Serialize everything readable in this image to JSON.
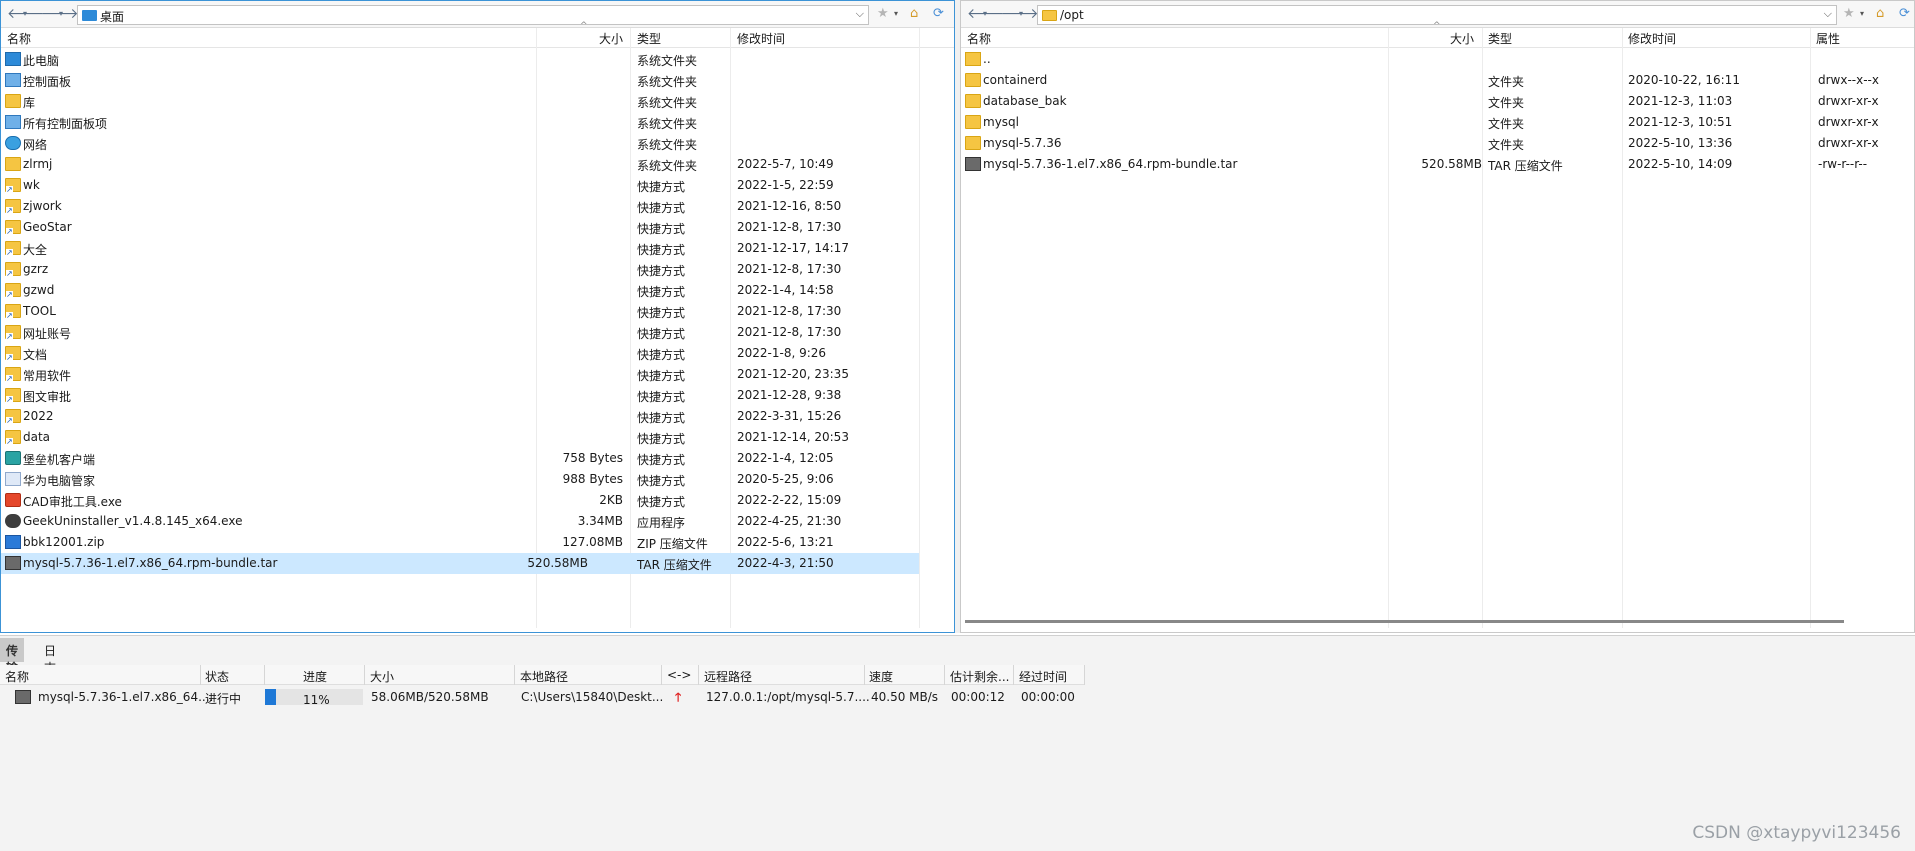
{
  "colors": {
    "accent": "#3c93d6",
    "selection": "#cce8ff",
    "progress": "#1e78d6",
    "upload_arrow": "#e02020"
  },
  "left": {
    "path": "桌面",
    "columns": {
      "name": "名称",
      "size": "大小",
      "type": "类型",
      "modified": "修改时间"
    },
    "rows": [
      {
        "icon": "pc-icon",
        "name": "此电脑",
        "size": "",
        "type": "系统文件夹",
        "modified": ""
      },
      {
        "icon": "control-panel-icon",
        "name": "控制面板",
        "size": "",
        "type": "系统文件夹",
        "modified": ""
      },
      {
        "icon": "folder-icon",
        "name": "库",
        "size": "",
        "type": "系统文件夹",
        "modified": ""
      },
      {
        "icon": "control-panel-icon",
        "name": "所有控制面板项",
        "size": "",
        "type": "系统文件夹",
        "modified": ""
      },
      {
        "icon": "network-icon",
        "name": "网络",
        "size": "",
        "type": "系统文件夹",
        "modified": ""
      },
      {
        "icon": "folder-icon",
        "name": "zlrmj",
        "size": "",
        "type": "系统文件夹",
        "modified": "2022-5-7, 10:49"
      },
      {
        "icon": "folder-shortcut-icon",
        "name": "wk",
        "size": "",
        "type": "快捷方式",
        "modified": "2022-1-5, 22:59"
      },
      {
        "icon": "folder-shortcut-icon",
        "name": "zjwork",
        "size": "",
        "type": "快捷方式",
        "modified": "2021-12-16, 8:50"
      },
      {
        "icon": "folder-shortcut-icon",
        "name": "GeoStar",
        "size": "",
        "type": "快捷方式",
        "modified": "2021-12-8, 17:30"
      },
      {
        "icon": "folder-shortcut-icon",
        "name": "大全",
        "size": "",
        "type": "快捷方式",
        "modified": "2021-12-17, 14:17"
      },
      {
        "icon": "folder-shortcut-icon",
        "name": "gzrz",
        "size": "",
        "type": "快捷方式",
        "modified": "2021-12-8, 17:30"
      },
      {
        "icon": "folder-shortcut-icon",
        "name": "gzwd",
        "size": "",
        "type": "快捷方式",
        "modified": "2022-1-4, 14:58"
      },
      {
        "icon": "folder-shortcut-icon",
        "name": "TOOL",
        "size": "",
        "type": "快捷方式",
        "modified": "2021-12-8, 17:30"
      },
      {
        "icon": "folder-shortcut-icon",
        "name": "网址账号",
        "size": "",
        "type": "快捷方式",
        "modified": "2021-12-8, 17:30"
      },
      {
        "icon": "folder-shortcut-icon",
        "name": "文档",
        "size": "",
        "type": "快捷方式",
        "modified": "2022-1-8, 9:26"
      },
      {
        "icon": "folder-shortcut-icon",
        "name": "常用软件",
        "size": "",
        "type": "快捷方式",
        "modified": "2021-12-20, 23:35"
      },
      {
        "icon": "folder-shortcut-icon",
        "name": "图文审批",
        "size": "",
        "type": "快捷方式",
        "modified": "2021-12-28, 9:38"
      },
      {
        "icon": "folder-shortcut-icon",
        "name": "2022",
        "size": "",
        "type": "快捷方式",
        "modified": "2022-3-31, 15:26"
      },
      {
        "icon": "folder-shortcut-icon",
        "name": "data",
        "size": "",
        "type": "快捷方式",
        "modified": "2021-12-14, 20:53"
      },
      {
        "icon": "app-icon",
        "name": "堡垒机客户端",
        "size": "758 Bytes",
        "type": "快捷方式",
        "modified": "2022-1-4, 12:05"
      },
      {
        "icon": "huawei-icon",
        "name": "华为电脑管家",
        "size": "988 Bytes",
        "type": "快捷方式",
        "modified": "2020-5-25, 9:06"
      },
      {
        "icon": "cad-icon",
        "name": "CAD审批工具.exe",
        "size": "2KB",
        "type": "快捷方式",
        "modified": "2022-2-22, 15:09"
      },
      {
        "icon": "geek-icon",
        "name": "GeekUninstaller_v1.4.8.145_x64.exe",
        "size": "3.34MB",
        "type": "应用程序",
        "modified": "2022-4-25, 21:30"
      },
      {
        "icon": "zip-icon",
        "name": "bbk12001.zip",
        "size": "127.08MB",
        "type": "ZIP 压缩文件",
        "modified": "2022-5-6, 13:21"
      },
      {
        "icon": "tar-icon",
        "name": "mysql-5.7.36-1.el7.x86_64.rpm-bundle.tar",
        "size": "520.58MB",
        "type": "TAR 压缩文件",
        "modified": "2022-4-3, 21:50",
        "selected": true
      }
    ]
  },
  "right": {
    "path": "/opt",
    "columns": {
      "name": "名称",
      "size": "大小",
      "type": "类型",
      "modified": "修改时间",
      "attr": "属性"
    },
    "rows": [
      {
        "icon": "parent-folder-icon",
        "name": "..",
        "size": "",
        "type": "",
        "modified": "",
        "attr": ""
      },
      {
        "icon": "folder-icon",
        "name": "containerd",
        "size": "",
        "type": "文件夹",
        "modified": "2020-10-22, 16:11",
        "attr": "drwx--x--x"
      },
      {
        "icon": "folder-icon",
        "name": "database_bak",
        "size": "",
        "type": "文件夹",
        "modified": "2021-12-3, 11:03",
        "attr": "drwxr-xr-x"
      },
      {
        "icon": "folder-icon",
        "name": "mysql",
        "size": "",
        "type": "文件夹",
        "modified": "2021-12-3, 10:51",
        "attr": "drwxr-xr-x"
      },
      {
        "icon": "folder-icon",
        "name": "mysql-5.7.36",
        "size": "",
        "type": "文件夹",
        "modified": "2022-5-10, 13:36",
        "attr": "drwxr-xr-x"
      },
      {
        "icon": "tar-icon",
        "name": "mysql-5.7.36-1.el7.x86_64.rpm-bundle.tar",
        "size": "520.58MB",
        "type": "TAR 压缩文件",
        "modified": "2022-5-10, 14:09",
        "attr": "-rw-r--r--"
      }
    ]
  },
  "bottom": {
    "tabs": [
      "传输",
      "日志"
    ],
    "columns": {
      "name": "名称",
      "status": "状态",
      "progress": "进度",
      "size": "大小",
      "local": "本地路径",
      "dir": "<->",
      "remote": "远程路径",
      "speed": "速度",
      "eta": "估计剩余...",
      "elapsed": "经过时间"
    },
    "transfer": {
      "name": "mysql-5.7.36-1.el7.x86_64....",
      "status": "进行中",
      "progress_fraction": 0.11,
      "progress_label": "11%",
      "size": "58.06MB/520.58MB",
      "local": "C:\\Users\\15840\\Deskt...",
      "remote": "127.0.0.1:/opt/mysql-5.7....",
      "speed": "40.50 MB/s",
      "eta": "00:00:12",
      "elapsed": "00:00:00"
    }
  },
  "watermark": "CSDN @xtaypyvi123456"
}
